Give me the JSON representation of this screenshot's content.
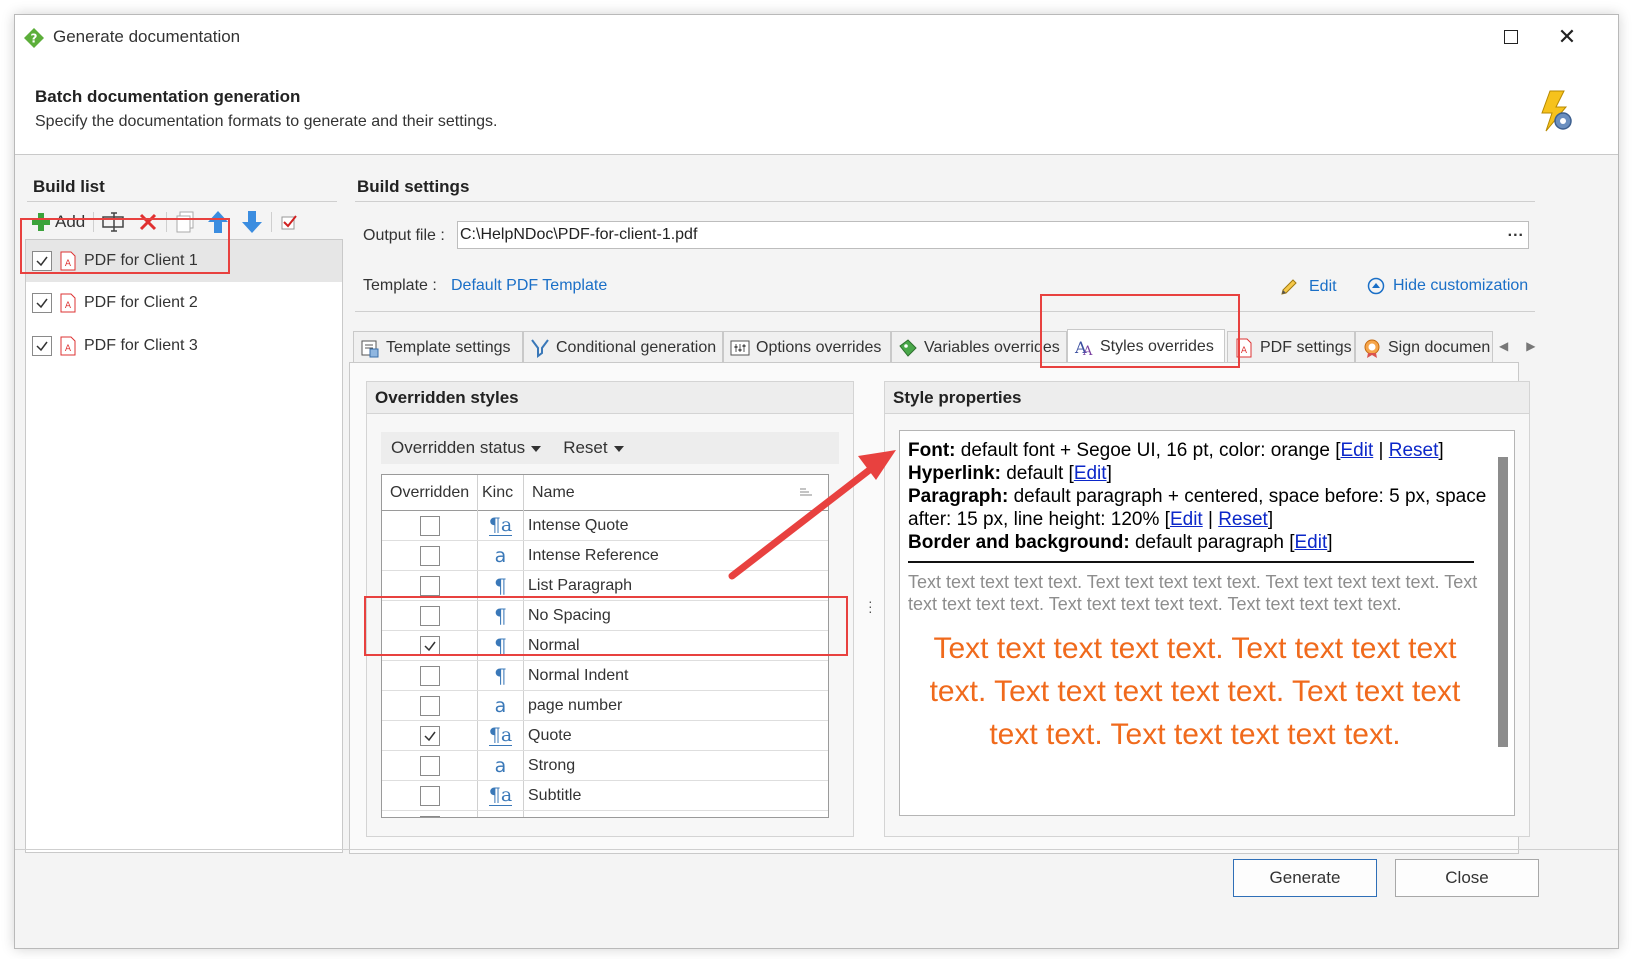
{
  "window": {
    "title": "Generate documentation"
  },
  "header": {
    "title": "Batch documentation generation",
    "subtitle": "Specify the documentation formats to generate and their settings."
  },
  "build_list": {
    "title": "Build list",
    "add_label": "Add",
    "items": [
      {
        "label": "PDF for Client 1",
        "checked": true,
        "selected": true
      },
      {
        "label": "PDF for Client 2",
        "checked": true,
        "selected": false
      },
      {
        "label": "PDF for Client 3",
        "checked": true,
        "selected": false
      }
    ]
  },
  "build_settings": {
    "title": "Build settings",
    "output_label": "Output file :",
    "output_value": "C:\\HelpNDoc\\PDF-for-client-1.pdf",
    "browse_label": "...",
    "template_label": "Template :",
    "template_link": "Default PDF Template",
    "edit_label": "Edit",
    "hide_label": "Hide customization"
  },
  "tabs": [
    {
      "label": "Template settings",
      "icon": "template-icon"
    },
    {
      "label": "Conditional generation",
      "icon": "filter-icon"
    },
    {
      "label": "Options overrides",
      "icon": "options-icon"
    },
    {
      "label": "Variables overrides",
      "icon": "variables-icon"
    },
    {
      "label": "Styles overrides",
      "icon": "styles-icon",
      "active": true
    },
    {
      "label": "PDF settings",
      "icon": "pdf-icon"
    },
    {
      "label": "Sign documen",
      "icon": "sign-icon"
    }
  ],
  "overridden_styles": {
    "title": "Overridden styles",
    "filter_status": "Overridden status",
    "filter_reset": "Reset",
    "columns": {
      "overridden": "Overridden",
      "kind": "Kinc",
      "name": "Name"
    },
    "rows": [
      {
        "name": "Intense Quote",
        "kind": "¶a",
        "overridden": false
      },
      {
        "name": "Intense Reference",
        "kind": "a",
        "overridden": false
      },
      {
        "name": "List Paragraph",
        "kind": "¶",
        "overridden": false
      },
      {
        "name": "No Spacing",
        "kind": "¶",
        "overridden": false
      },
      {
        "name": "Normal",
        "kind": "¶",
        "overridden": true
      },
      {
        "name": "Normal Indent",
        "kind": "¶",
        "overridden": false
      },
      {
        "name": "page number",
        "kind": "a",
        "overridden": false
      },
      {
        "name": "Quote",
        "kind": "¶a",
        "overridden": true
      },
      {
        "name": "Strong",
        "kind": "a",
        "overridden": false
      },
      {
        "name": "Subtitle",
        "kind": "¶a",
        "overridden": false
      }
    ]
  },
  "style_properties": {
    "title": "Style properties",
    "font_label": "Font:",
    "font_value": " default font + Segoe UI, 16 pt, color: orange ",
    "hyperlink_label": "Hyperlink:",
    "hyperlink_value": " default ",
    "paragraph_label": "Paragraph:",
    "paragraph_value": " default paragraph + centered, space before: 5 px, space after: 15 px, line height: 120% ",
    "border_label": "Border and background:",
    "border_value": "  default paragraph ",
    "edit_link": "Edit",
    "reset_link": "Reset",
    "sample_grey": "Text text text text text. Text text text text text. Text text text text text. Text text text text text. Text text text text text. Text text text text text.",
    "sample_orange": "Text text text text text. Text text text text text. Text text text text text. Text text text text text. Text text text text text."
  },
  "footer": {
    "generate_label": "Generate",
    "close_label": "Close"
  },
  "colors": {
    "accent": "#1a6fc7",
    "annotation": "#e8413f",
    "sample_orange": "#f06a1c"
  }
}
